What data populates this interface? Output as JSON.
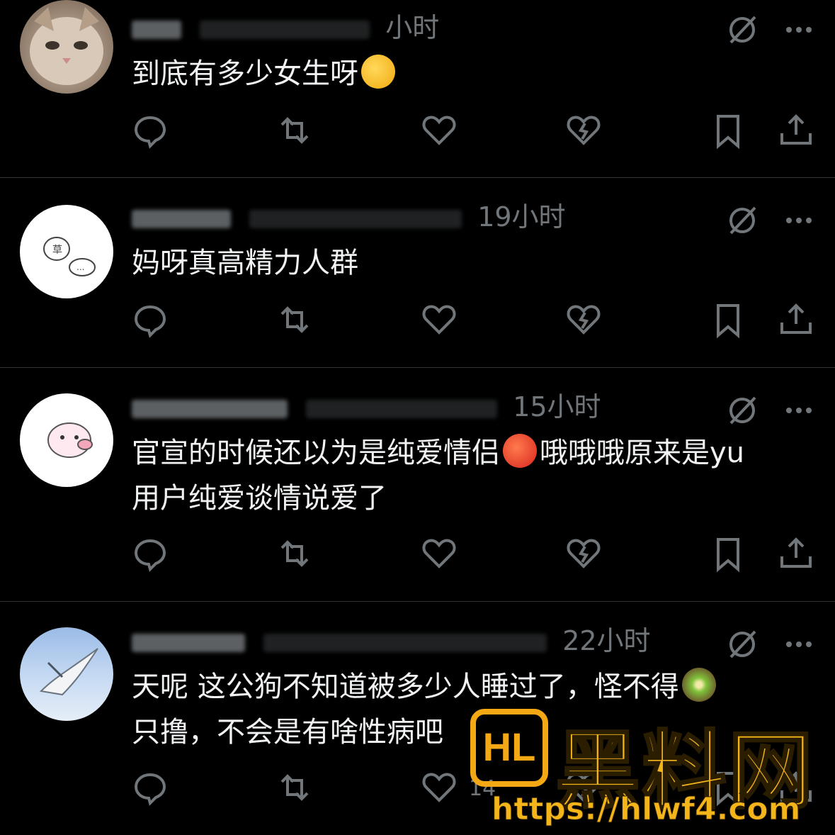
{
  "colors": {
    "background": "#000000",
    "text": "#e7e9ea",
    "muted": "#71767b",
    "divider": "#2f3336",
    "watermark": "#f4b51a"
  },
  "posts": [
    {
      "time": "小时",
      "body_lines": [
        "到底有多少女生呀"
      ],
      "emoji": "monocle-face-emoji"
    },
    {
      "time": "19小时",
      "body_lines": [
        "妈呀真高精力人群"
      ]
    },
    {
      "time": "15小时",
      "body_lines": [
        "官宣的时候还以为是纯爱情侣",
        "哦哦哦原来是yu",
        "用户纯爱谈情说爱了"
      ],
      "emoji": "angry-face-emoji"
    },
    {
      "time": "22小时",
      "body_lines": [
        "天呢 这公狗不知道被多少人睡过了，怪不得",
        "只撸，不会是有啥性病吧"
      ],
      "emoji": "kiwi-emoji",
      "like_count": "14"
    }
  ],
  "watermark": {
    "logo": "HL",
    "title": "黑料网",
    "url": "https://hlwf4.com"
  },
  "icons": [
    "reply-icon",
    "retweet-icon",
    "like-icon",
    "dislike-icon",
    "bookmark-icon",
    "share-icon",
    "mute-icon",
    "more-icon"
  ]
}
